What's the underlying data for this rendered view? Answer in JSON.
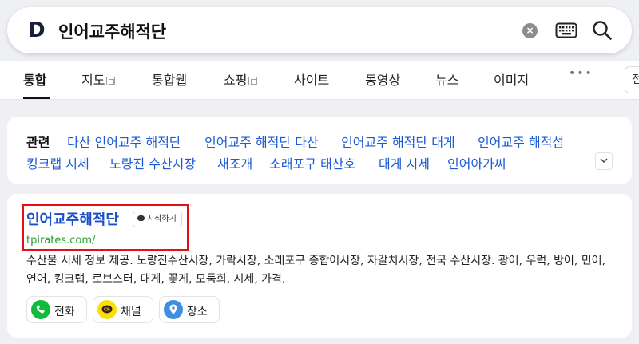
{
  "search": {
    "logo": "D",
    "query": "인어교주해적단",
    "clear_icon": "×"
  },
  "tabs": [
    {
      "label": "통합",
      "active": true
    },
    {
      "label": "지도",
      "external": true
    },
    {
      "label": "통합웹"
    },
    {
      "label": "쇼핑",
      "external": true
    },
    {
      "label": "사이트"
    },
    {
      "label": "동영상"
    },
    {
      "label": "뉴스"
    },
    {
      "label": "이미지"
    }
  ],
  "tabs_more": "•••",
  "tabs_cut_label": "전",
  "related": {
    "title": "관련",
    "links": [
      "다산 인어교주 해적단",
      "인어교주 해적단 다산",
      "인어교주 해적단 대게",
      "인어교주 해적섬",
      "킹크랩 시세",
      "노량진 수산시장",
      "새조개",
      "소래포구 태산호",
      "대게 시세",
      "인어아가씨"
    ],
    "expand_icon": "chevron-down-icon"
  },
  "result": {
    "title": "인어교주해적단",
    "badge": "시작하기",
    "url": "tpirates.com/",
    "description": "수산물 시세 정보 제공. 노량진수산시장, 가락시장, 소래포구 종합어시장, 자갈치시장, 전국 수산시장. 광어, 우럭, 방어, 민어, 연어, 킹크랩, 로브스터, 대게, 꽃게, 모둠회, 시세, 가격.",
    "actions": [
      {
        "label": "전화",
        "icon": "phone-icon"
      },
      {
        "label": "채널",
        "icon": "kakao-channel-icon"
      },
      {
        "label": "장소",
        "icon": "location-pin-icon"
      }
    ]
  },
  "colors": {
    "link": "#1a5ad6",
    "title_link": "#1a4fc9",
    "url": "#2aa02f",
    "highlight_box": "#e60f16"
  }
}
